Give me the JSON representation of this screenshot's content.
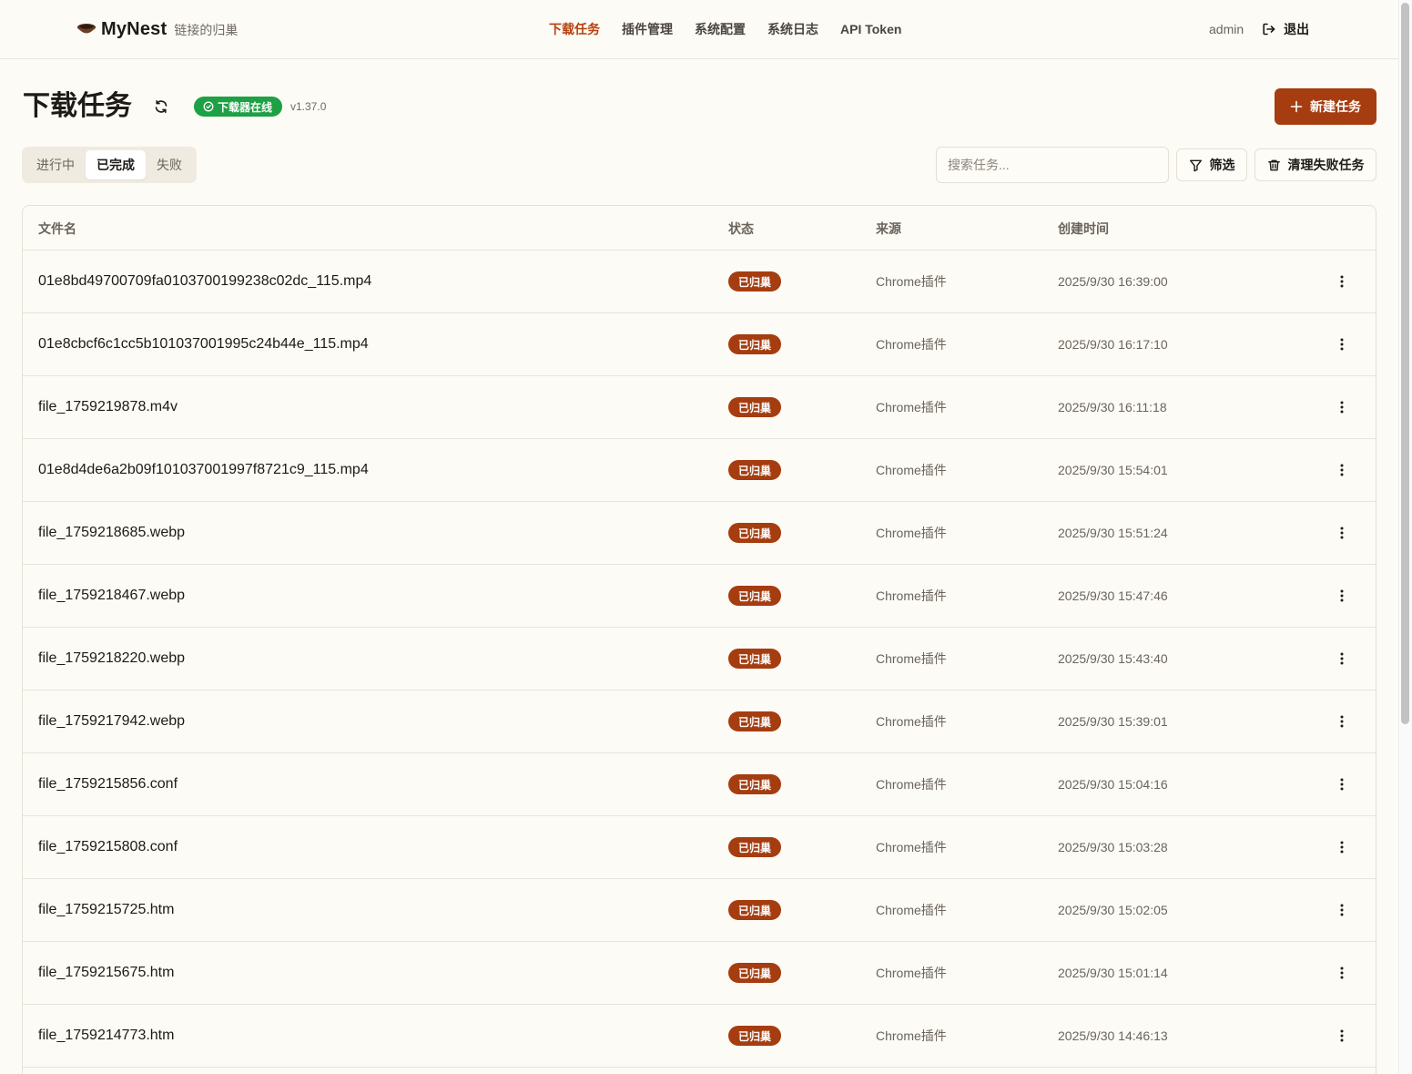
{
  "header": {
    "brand_name": "MyNest",
    "brand_tagline": "链接的归巢",
    "nav": [
      "下载任务",
      "插件管理",
      "系统配置",
      "系统日志",
      "API Token"
    ],
    "active_nav_index": 0,
    "username": "admin",
    "logout_label": "退出"
  },
  "page": {
    "title": "下载任务",
    "downloader_status": "下载器在线",
    "version": "v1.37.0",
    "new_task_label": "新建任务"
  },
  "tabs": {
    "items": [
      "进行中",
      "已完成",
      "失败"
    ],
    "active_index": 1
  },
  "toolbar": {
    "search_placeholder": "搜索任务...",
    "filter_label": "筛选",
    "clear_failed_label": "清理失败任务"
  },
  "table": {
    "columns": {
      "filename": "文件名",
      "status": "状态",
      "source": "来源",
      "created": "创建时间"
    },
    "rows": [
      {
        "name": "01e8bd49700709fa0103700199238c02dc_115.mp4",
        "status": "已归巢",
        "source": "Chrome插件",
        "created": "2025/9/30 16:39:00"
      },
      {
        "name": "01e8cbcf6c1cc5b101037001995c24b44e_115.mp4",
        "status": "已归巢",
        "source": "Chrome插件",
        "created": "2025/9/30 16:17:10"
      },
      {
        "name": "file_1759219878.m4v",
        "status": "已归巢",
        "source": "Chrome插件",
        "created": "2025/9/30 16:11:18"
      },
      {
        "name": "01e8d4de6a2b09f101037001997f8721c9_115.mp4",
        "status": "已归巢",
        "source": "Chrome插件",
        "created": "2025/9/30 15:54:01"
      },
      {
        "name": "file_1759218685.webp",
        "status": "已归巢",
        "source": "Chrome插件",
        "created": "2025/9/30 15:51:24"
      },
      {
        "name": "file_1759218467.webp",
        "status": "已归巢",
        "source": "Chrome插件",
        "created": "2025/9/30 15:47:46"
      },
      {
        "name": "file_1759218220.webp",
        "status": "已归巢",
        "source": "Chrome插件",
        "created": "2025/9/30 15:43:40"
      },
      {
        "name": "file_1759217942.webp",
        "status": "已归巢",
        "source": "Chrome插件",
        "created": "2025/9/30 15:39:01"
      },
      {
        "name": "file_1759215856.conf",
        "status": "已归巢",
        "source": "Chrome插件",
        "created": "2025/9/30 15:04:16"
      },
      {
        "name": "file_1759215808.conf",
        "status": "已归巢",
        "source": "Chrome插件",
        "created": "2025/9/30 15:03:28"
      },
      {
        "name": "file_1759215725.htm",
        "status": "已归巢",
        "source": "Chrome插件",
        "created": "2025/9/30 15:02:05"
      },
      {
        "name": "file_1759215675.htm",
        "status": "已归巢",
        "source": "Chrome插件",
        "created": "2025/9/30 15:01:14"
      },
      {
        "name": "file_1759214773.htm",
        "status": "已归巢",
        "source": "Chrome插件",
        "created": "2025/9/30 14:46:13"
      }
    ]
  },
  "colors": {
    "accent": "#a53d10",
    "online": "#1ea044",
    "background": "#fdfbf5"
  },
  "icons": {
    "logo": "nest-bowl-icon",
    "refresh": "refresh-icon",
    "online": "check-circle-icon",
    "new": "plus-icon",
    "filter": "filter-icon",
    "clear": "trash-icon",
    "logout": "logout-icon",
    "row_menu": "more-vertical-icon"
  }
}
